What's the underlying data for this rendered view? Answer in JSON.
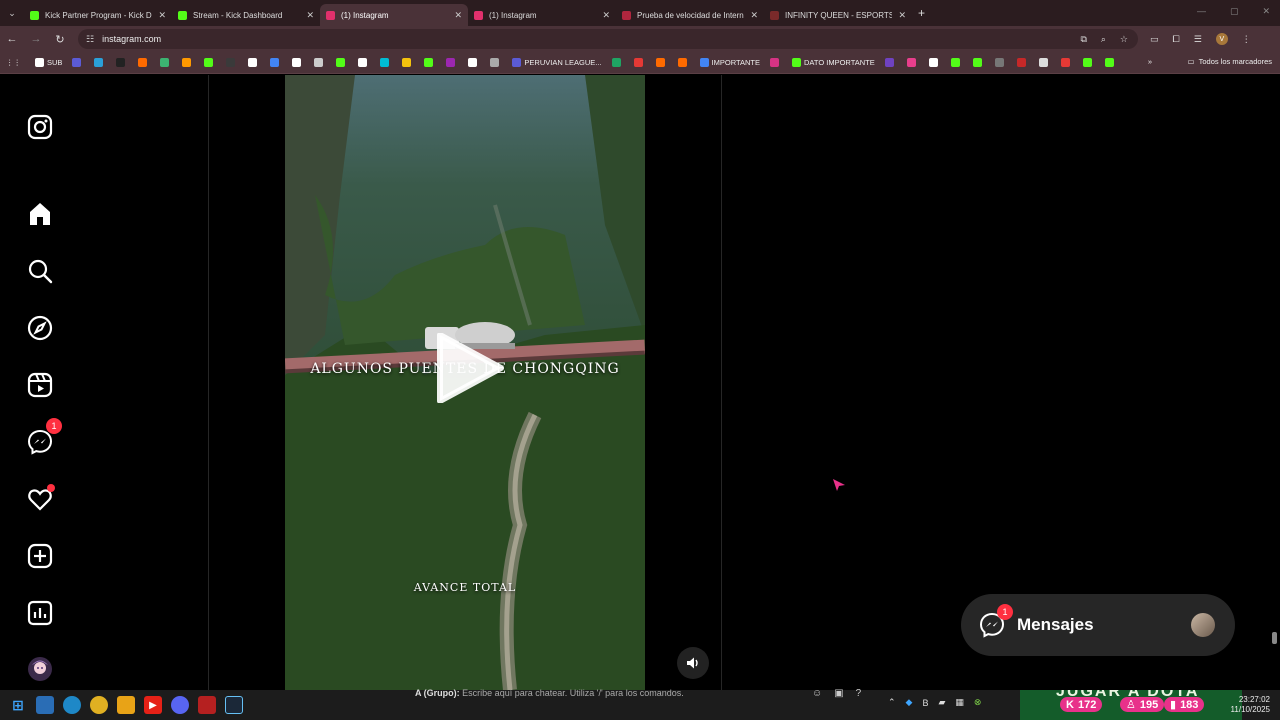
{
  "browser": {
    "tabs": [
      {
        "title": "Kick Partner Program - Kick Dashboard",
        "active": false,
        "favicon_color": "#53fc18"
      },
      {
        "title": "Stream - Kick Dashboard",
        "active": false,
        "favicon_color": "#53fc18"
      },
      {
        "title": "(1) Instagram",
        "active": true,
        "favicon_color": "#e1306c"
      },
      {
        "title": "(1) Instagram",
        "active": false,
        "favicon_color": "#e1306c"
      },
      {
        "title": "Prueba de velocidad de Internet",
        "active": false,
        "favicon_color": "#b0263e"
      },
      {
        "title": "INFINITY QUEEN - ESPORTS FEMENINO",
        "active": false,
        "favicon_color": "#7a2a2a"
      }
    ],
    "url": "instagram.com",
    "bookmarks": [
      {
        "label": "SUB",
        "color": "#ffffff"
      },
      {
        "label": "",
        "color": "#5b5bd6"
      },
      {
        "label": "",
        "color": "#2aa0d8"
      },
      {
        "label": "",
        "color": "#222222"
      },
      {
        "label": "",
        "color": "#ff6a00"
      },
      {
        "label": "",
        "color": "#3cb371"
      },
      {
        "label": "",
        "color": "#ff9900"
      },
      {
        "label": "",
        "color": "#53fc18"
      },
      {
        "label": "",
        "color": "#3a3a3a"
      },
      {
        "label": "",
        "color": "#ffffff"
      },
      {
        "label": "",
        "color": "#4285f4"
      },
      {
        "label": "",
        "color": "#ffffff"
      },
      {
        "label": "",
        "color": "#cccccc"
      },
      {
        "label": "",
        "color": "#53fc18"
      },
      {
        "label": "",
        "color": "#ffffff"
      },
      {
        "label": "",
        "color": "#00bcd4"
      },
      {
        "label": "",
        "color": "#f4c20d"
      },
      {
        "label": "",
        "color": "#53fc18"
      },
      {
        "label": "",
        "color": "#9c27b0"
      },
      {
        "label": "",
        "color": "#ffffff"
      },
      {
        "label": "",
        "color": "#aaaaaa"
      },
      {
        "label": "PERUVIAN LEAGUE...",
        "color": "#5b5bd6"
      },
      {
        "label": "",
        "color": "#1fa463"
      },
      {
        "label": "",
        "color": "#e53935"
      },
      {
        "label": "",
        "color": "#ff6a00"
      },
      {
        "label": "",
        "color": "#ff6a00"
      },
      {
        "label": "IMPORTANTE",
        "color": "#4285f4"
      },
      {
        "label": "",
        "color": "#d63384"
      },
      {
        "label": "DATO IMPORTANTE",
        "color": "#53fc18"
      },
      {
        "label": "",
        "color": "#6f42c1"
      },
      {
        "label": "",
        "color": "#e83e8c"
      },
      {
        "label": "",
        "color": "#ffffff"
      },
      {
        "label": "",
        "color": "#53fc18"
      },
      {
        "label": "",
        "color": "#53fc18"
      },
      {
        "label": "",
        "color": "#777777"
      },
      {
        "label": "",
        "color": "#c62828"
      },
      {
        "label": "",
        "color": "#dddddd"
      },
      {
        "label": "",
        "color": "#e53935"
      },
      {
        "label": "",
        "color": "#53fc18"
      },
      {
        "label": "",
        "color": "#53fc18"
      }
    ],
    "all_bookmarks_label": "Todos los marcadores",
    "profile_initial": "V"
  },
  "instagram": {
    "nav": [
      {
        "name": "instagram-logo-icon"
      },
      {
        "name": "home-icon"
      },
      {
        "name": "search-icon"
      },
      {
        "name": "explore-icon"
      },
      {
        "name": "reels-icon"
      },
      {
        "name": "messenger-icon",
        "badge": "1"
      },
      {
        "name": "notifications-icon"
      },
      {
        "name": "create-icon"
      },
      {
        "name": "dashboard-icon"
      },
      {
        "name": "profile-avatar"
      }
    ],
    "reel": {
      "caption_top": "ALGUNOS PUENTES DE CHONGQING",
      "caption_bottom": "AVANCE TOTAL"
    },
    "messages": {
      "label": "Mensajes",
      "badge": "1"
    }
  },
  "taskbar": {
    "chat_group": "A (Grupo):",
    "chat_placeholder": "Escribe aquí para chatear. Utiliza '/' para los comandos.",
    "banner_text": "JUGAR A DOTA",
    "stats": {
      "kick": "172",
      "followers": "195",
      "viewers": "183"
    },
    "time": "23:27:02",
    "date": "11/10/2025"
  }
}
